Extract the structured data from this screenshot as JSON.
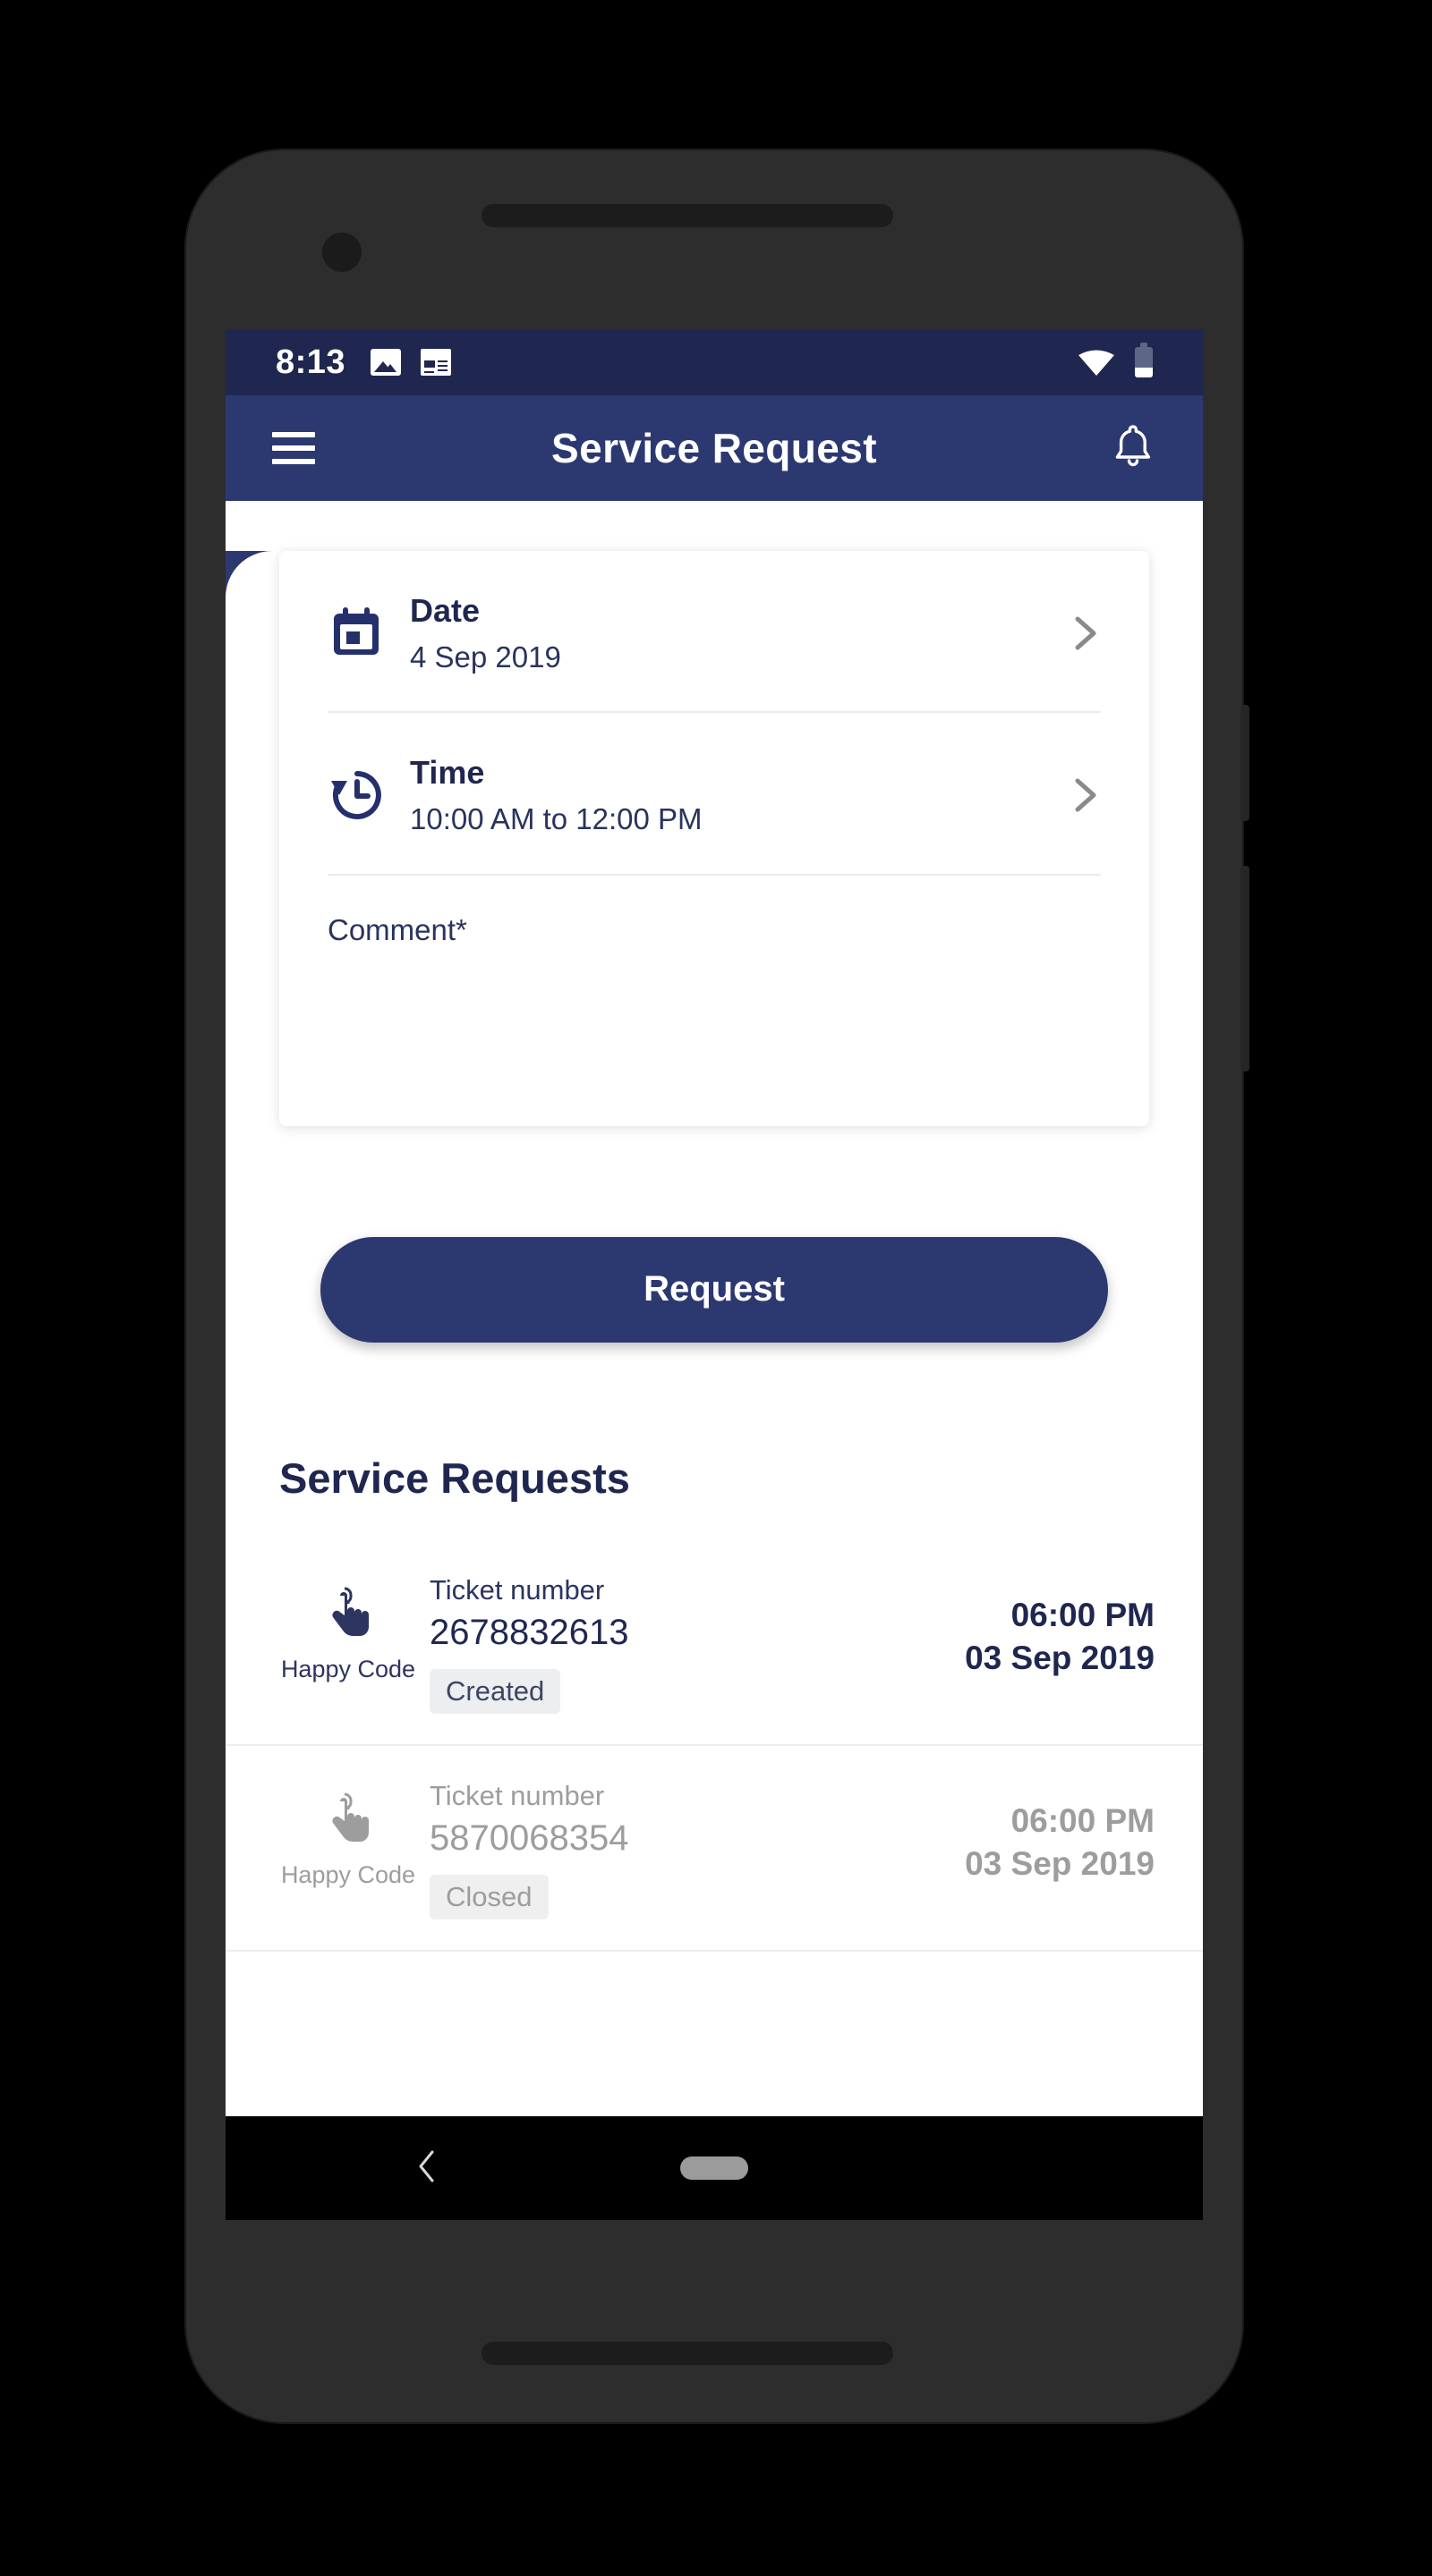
{
  "status_bar": {
    "time": "8:13",
    "left_icons": [
      "image-icon",
      "news-icon"
    ],
    "right_icons": [
      "wifi-icon",
      "battery-icon"
    ]
  },
  "app_bar": {
    "menu_icon": "hamburger-menu-icon",
    "title": "Service Request",
    "notification_icon": "bell-icon"
  },
  "form": {
    "date_row": {
      "icon": "calendar-icon",
      "label": "Date",
      "value": "4 Sep 2019",
      "chevron": "chevron-right-icon"
    },
    "time_row": {
      "icon": "history-clock-icon",
      "label": "Time",
      "value": "10:00 AM to 12:00 PM",
      "chevron": "chevron-right-icon"
    },
    "comment": {
      "label": "Comment*",
      "value": "",
      "placeholder": ""
    },
    "submit_label": "Request"
  },
  "requests_section": {
    "heading": "Service Requests",
    "items": [
      {
        "icon": "tap-hand-icon",
        "icon_label": "Happy Code",
        "ticket_label": "Ticket number",
        "ticket_number": "2678832613",
        "status": "Created",
        "time": "06:00 PM",
        "date": "03 Sep 2019",
        "state": "active"
      },
      {
        "icon": "tap-hand-icon",
        "icon_label": "Happy Code",
        "ticket_label": "Ticket number",
        "ticket_number": "5870068354",
        "status": "Closed",
        "time": "06:00 PM",
        "date": "03 Sep 2019",
        "state": "dimmed"
      }
    ]
  },
  "nav_bar": {
    "back_icon": "back-chevron-icon",
    "home_indicator": "home-pill-indicator"
  },
  "colors": {
    "primary": "#2c3870",
    "status_bar": "#1f2750",
    "text_dark": "#1f2750",
    "muted": "#9d9d9d",
    "badge_bg": "#eceef0"
  }
}
